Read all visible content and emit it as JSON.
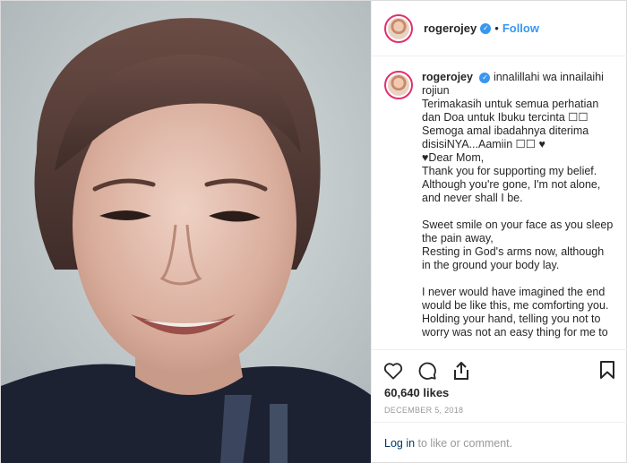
{
  "post": {
    "username": "rogerojey",
    "verified_icon": "verified-badge-icon",
    "separator": "•",
    "follow_label": "Follow"
  },
  "caption": {
    "username": "rogerojey",
    "lines": [
      "innalillahi wa innailaihi",
      "rojiun",
      "Terimakasih untuk semua perhatian",
      "dan Doa untuk Ibuku tercinta ☐☐",
      "Semoga amal ibadahnya diterima",
      "disisiNYA...Aamiin ☐☐ ♥",
      "♥Dear Mom,",
      "Thank you for supporting my belief.",
      "Although you're gone, I'm not alone,",
      "and never shall I be.",
      "",
      "Sweet smile on your face as you sleep",
      "the pain away,",
      "Resting in God's arms now, although",
      "in the ground your body lay.",
      "",
      "I never would have imagined the end",
      "would be like this, me comforting you.",
      "Holding your hand, telling you not to",
      "worry was not an easy thing for me to"
    ]
  },
  "stats": {
    "likes": "60,640 likes",
    "date": "DECEMBER 5, 2018"
  },
  "login": {
    "link": "Log in",
    "rest": " to like or comment."
  },
  "icons": [
    "heart-icon",
    "comment-icon",
    "share-icon",
    "bookmark-icon"
  ],
  "colors": {
    "accent": "#3897f0",
    "text": "#262626",
    "muted": "#999999",
    "link": "#003569",
    "border": "#efefef"
  }
}
